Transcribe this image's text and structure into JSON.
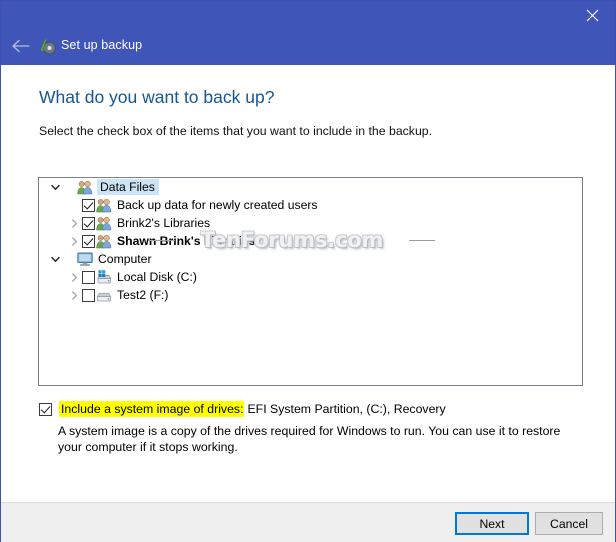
{
  "window": {
    "title": "Set up backup",
    "title_icon": "backup-disc-icon",
    "back_icon": "back-arrow-icon",
    "close_icon": "close-icon",
    "accent_color": "#4055b8"
  },
  "page": {
    "heading": "What do you want to back up?",
    "subheading": "Select the check box of the items that you want to include in the backup.",
    "heading_color": "#17578f"
  },
  "watermark": {
    "text": "TenForums.com"
  },
  "tree": {
    "rows": [
      {
        "label": "Data Files",
        "level": 0,
        "expander": "chevron-down",
        "checkbox": "none",
        "icon": "users-icon",
        "selected": true,
        "bold": false
      },
      {
        "label": "Back up data for newly created users",
        "level": 1,
        "expander": "none",
        "checkbox": "checked",
        "icon": "users-icon",
        "selected": false,
        "bold": false
      },
      {
        "label": "Brink2's Libraries",
        "level": 1,
        "expander": "chevron-right",
        "checkbox": "checked",
        "icon": "users-icon",
        "selected": false,
        "bold": false
      },
      {
        "label": "Shawn Brink's Libraries",
        "level": 1,
        "expander": "chevron-right",
        "checkbox": "checked",
        "icon": "users-icon",
        "selected": false,
        "bold": true
      },
      {
        "label": "Computer",
        "level": 0,
        "expander": "chevron-down",
        "checkbox": "none",
        "icon": "monitor-icon",
        "selected": false,
        "bold": false
      },
      {
        "label": "Local Disk (C:)",
        "level": 1,
        "expander": "chevron-right",
        "checkbox": "unchecked",
        "icon": "windows-drive-icon",
        "selected": false,
        "bold": false
      },
      {
        "label": "Test2 (F:)",
        "level": 1,
        "expander": "chevron-right",
        "checkbox": "unchecked",
        "icon": "drive-icon",
        "selected": false,
        "bold": false
      }
    ]
  },
  "system_image": {
    "checkbox_state": "checked",
    "label": "Include a system image of drives:",
    "drives": "EFI System Partition, (C:), Recovery",
    "highlight_color": "#ffff00",
    "description": "A system image is a copy of the drives required for Windows to run. You can use it to restore your computer if it stops working."
  },
  "footer": {
    "next_label": "Next",
    "cancel_label": "Cancel",
    "focus_color": "#0078d7"
  }
}
